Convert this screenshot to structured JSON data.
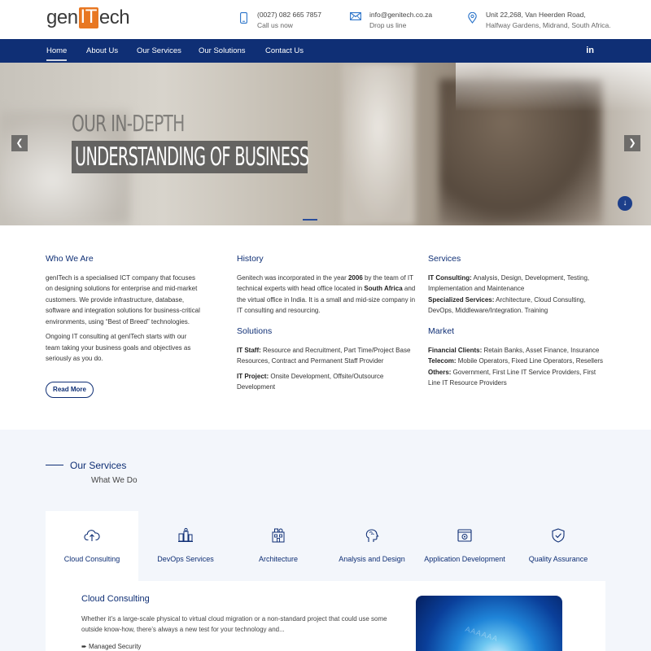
{
  "brand": {
    "logo_pre": "gen",
    "logo_mid": "IT",
    "logo_post": "ech"
  },
  "contacts": [
    {
      "icon": "phone-icon",
      "line1": "(0027) 082 665 7857",
      "line2": "Call us now"
    },
    {
      "icon": "mail-icon",
      "line1": "info@genitech.co.za",
      "line2": "Drop us line"
    },
    {
      "icon": "location-pin-icon",
      "line1": "Unit 22,268, Van Heerden Road,",
      "line2": "Halfway Gardens, Midrand, South Africa."
    }
  ],
  "nav": {
    "items": [
      "Home",
      "About Us",
      "Our Services",
      "Our Solutions",
      "Contact Us"
    ],
    "social": "in"
  },
  "hero": {
    "line1": "OUR IN-DEPTH",
    "line2": "UNDERSTANDING OF BUSINESS",
    "prev": "❮",
    "next": "❯",
    "down": "↓"
  },
  "who": {
    "title": "Who We Are",
    "p1": "genITech is a specialised ICT company that focuses on designing solutions for enterprise and mid-market customers. We provide infrastructure, database, software and integration solutions for business-critical environments, using “Best of Breed” technologies.",
    "p2": "Ongoing IT consulting at genITech starts with our team taking your business goals and objectives as seriously as you do.",
    "button": "Read More"
  },
  "history": {
    "title": "History",
    "t1": "Genitech was incorporated in the year ",
    "b1": "2006",
    "t2": " by the team of IT technical experts with head office located in ",
    "b2": "South Africa",
    "t3": " and the virtual office in India. It is a small and mid-size company in IT consulting and resourcing."
  },
  "solutions": {
    "title": "Solutions",
    "l1b": "IT Staff:",
    "l1": " Resource and Recruitment, Part Time/Project Base Resources, Contract and Permanent Staff Provider",
    "l2b": "IT Project:",
    "l2": " Onsite Development, Offsite/Outsource Development"
  },
  "services_col": {
    "title": "Services",
    "l1b": "IT Consulting:",
    "l1": " Analysis, Design, Development, Testing, Implementation and Maintenance",
    "l2b": "Specialized Services:",
    "l2": " Architecture, Cloud Consulting, DevOps, Middleware/Integration. Training"
  },
  "market": {
    "title": "Market",
    "l1b": "Financial Clients:",
    "l1": " Retain Banks, Asset Finance, Insurance",
    "l2b": "Telecom:",
    "l2": " Mobile Operators, Fixed Line Operators, Resellers",
    "l3b": "Others:",
    "l3": " Government, First Line IT Service Providers, First Line IT Resource Providers"
  },
  "our_services": {
    "title": "Our Services",
    "subtitle": "What We Do",
    "tabs": [
      {
        "label": "Cloud Consulting",
        "icon": "cloud-upload-icon"
      },
      {
        "label": "DevOps Services",
        "icon": "devops-icon"
      },
      {
        "label": "Architecture",
        "icon": "architecture-icon"
      },
      {
        "label": "Analysis and Design",
        "icon": "brain-icon"
      },
      {
        "label": "Application Development",
        "icon": "app-window-icon"
      },
      {
        "label": "Quality Assurance",
        "icon": "shield-check-icon"
      }
    ],
    "panel_title": "Cloud Consulting",
    "panel_desc": "Whether it’s a large-scale physical to virtual cloud migration or a non-standard project that could use some outside know-how, there’s always a new test for your technology and...",
    "panel_bullet": "Managed Security"
  }
}
